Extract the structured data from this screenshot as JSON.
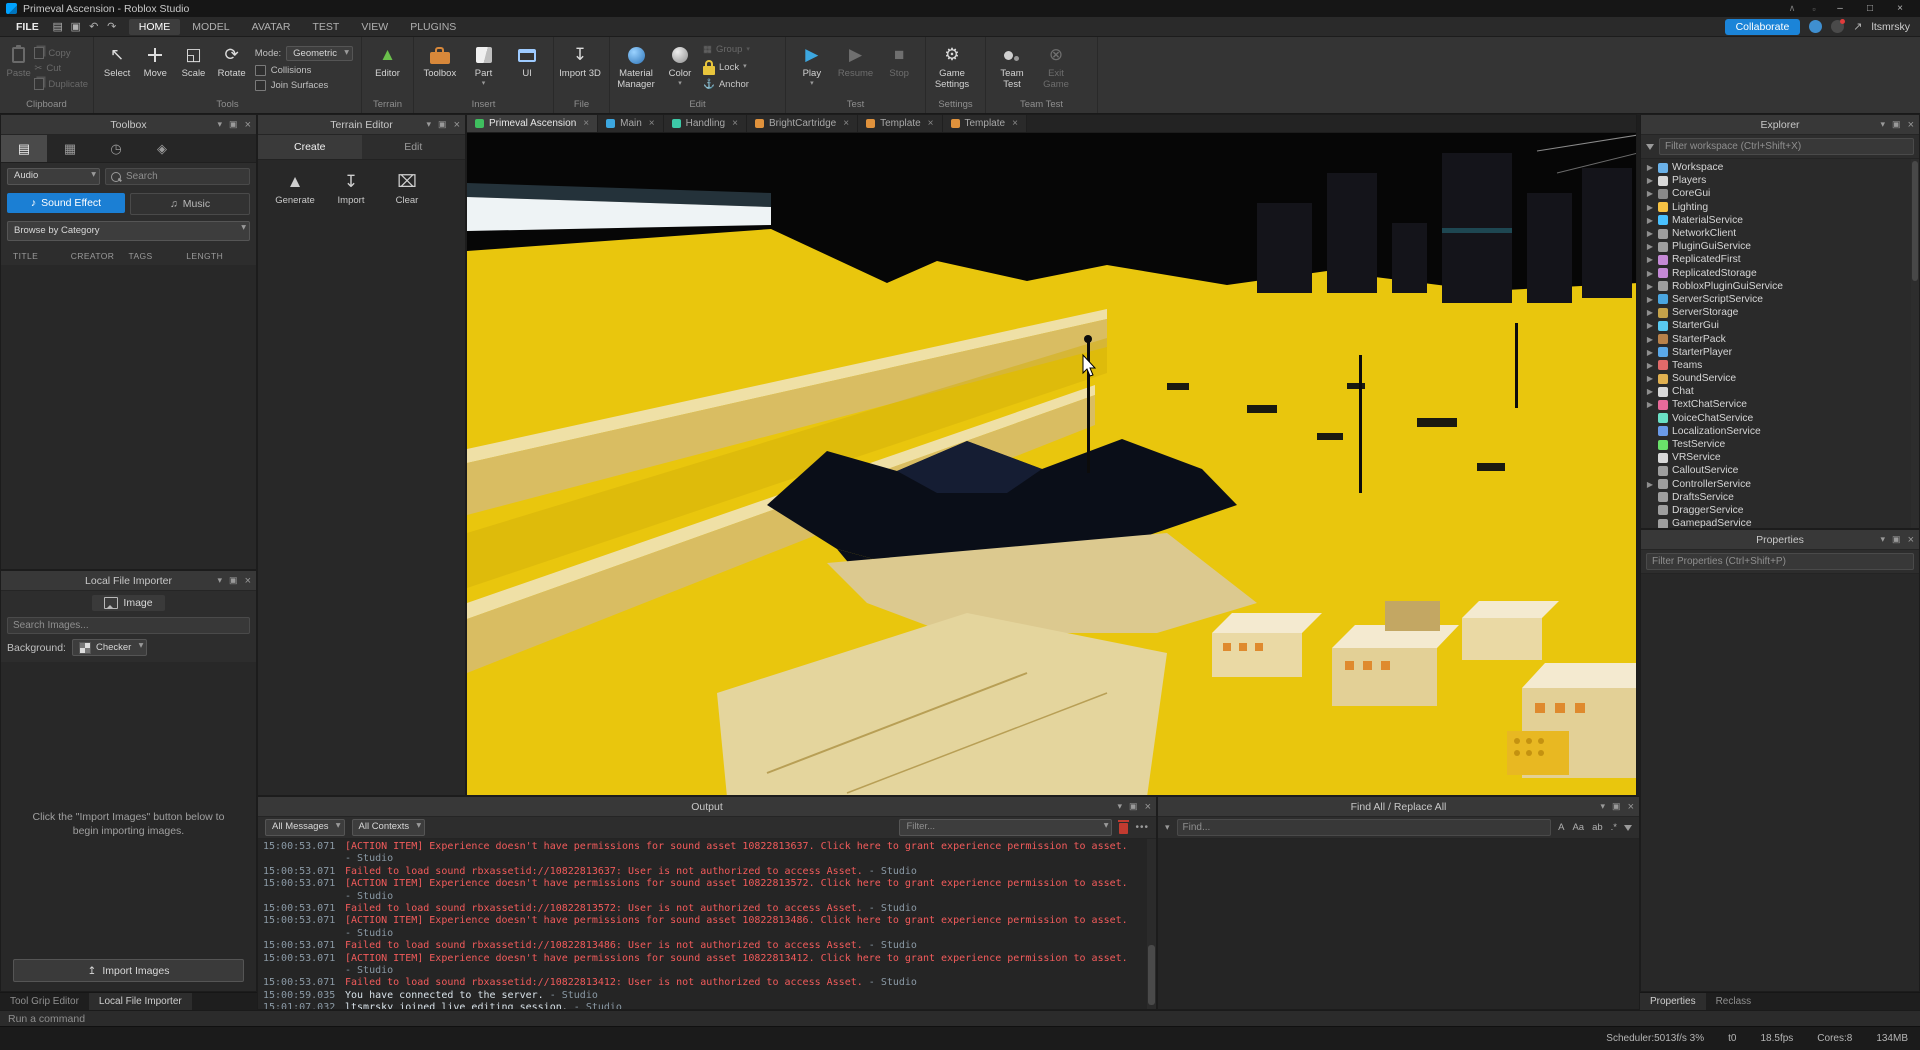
{
  "titlebar": {
    "title": "Primeval Ascension - Roblox Studio"
  },
  "menubar": {
    "file_label": "FILE",
    "icons": [
      {
        "name": "open-icon",
        "glyph": "▤"
      },
      {
        "name": "save-icon",
        "glyph": "▣"
      },
      {
        "name": "undo-icon",
        "glyph": "↶"
      },
      {
        "name": "redo-icon",
        "glyph": "↷"
      }
    ],
    "tabs": [
      {
        "label": "HOME",
        "active": true
      },
      {
        "label": "MODEL",
        "active": false
      },
      {
        "label": "AVATAR",
        "active": false
      },
      {
        "label": "TEST",
        "active": false
      },
      {
        "label": "VIEW",
        "active": false
      },
      {
        "label": "PLUGINS",
        "active": false
      }
    ],
    "collaborate_label": "Collaborate",
    "username": "ltsmrsky"
  },
  "ribbon": {
    "clipboard": {
      "label": "Clipboard",
      "paste": "Paste",
      "copy": "Copy",
      "cut": "Cut",
      "duplicate": "Duplicate"
    },
    "tools": {
      "label": "Tools",
      "select": "Select",
      "move": "Move",
      "scale": "Scale",
      "rotate": "Rotate",
      "mode_label": "Mode:",
      "mode_value": "Geometric",
      "collisions": "Collisions",
      "join_surfaces": "Join Surfaces"
    },
    "terrain": {
      "label": "Terrain",
      "editor": "Editor"
    },
    "insert": {
      "label": "Insert",
      "toolbox": "Toolbox",
      "part": "Part",
      "ui": "UI"
    },
    "file": {
      "label": "File",
      "import_3d": "Import 3D"
    },
    "edit": {
      "label": "Edit",
      "material_manager": "Material Manager",
      "color": "Color",
      "group": "Group",
      "lock": "Lock",
      "anchor": "Anchor"
    },
    "test": {
      "label": "Test",
      "play": "Play",
      "resume": "Resume",
      "stop": "Stop"
    },
    "settings": {
      "label": "Settings",
      "game_settings": "Game Settings"
    },
    "team_test": {
      "label": "Team Test",
      "team_test": "Team Test",
      "exit_game": "Exit Game"
    }
  },
  "toolbox": {
    "title": "Toolbox",
    "tabs": [
      {
        "name": "marketplace-tab",
        "glyph": "▤",
        "active": true
      },
      {
        "name": "inventory-tab",
        "glyph": "▦",
        "active": false
      },
      {
        "name": "recent-tab",
        "glyph": "◷",
        "active": false
      },
      {
        "name": "creations-tab",
        "glyph": "◈",
        "active": false
      }
    ],
    "category_value": "Audio",
    "search_placeholder": "Search",
    "sound_effect_label": "Sound Effect",
    "music_label": "Music",
    "browse_label": "Browse by Category",
    "columns": [
      "TITLE",
      "CREATOR",
      "TAGS",
      "LENGTH"
    ]
  },
  "local_file_importer": {
    "title": "Local File Importer",
    "tab_label": "Image",
    "search_placeholder": "Search Images...",
    "background_label": "Background:",
    "background_value": "Checker",
    "empty_text": "Click the \"Import Images\" button below to begin importing images.",
    "import_button": "Import Images"
  },
  "terrain_editor": {
    "title": "Terrain Editor",
    "tabs": [
      {
        "label": "Create",
        "active": true
      },
      {
        "label": "Edit",
        "active": false
      }
    ],
    "buttons": [
      {
        "label": "Generate",
        "glyph": "▲",
        "icon": "generate-icon"
      },
      {
        "label": "Import",
        "glyph": "↧",
        "icon": "import-icon"
      },
      {
        "label": "Clear",
        "glyph": "⌧",
        "icon": "clear-icon"
      }
    ]
  },
  "document_tabs": [
    {
      "label": "Primeval Ascension",
      "color": "#3fbf5f",
      "active": true
    },
    {
      "label": "Main",
      "color": "#3ca7e0",
      "active": false
    },
    {
      "label": "Handling",
      "color": "#3cc9a7",
      "active": false
    },
    {
      "label": "BrightCartridge",
      "color": "#e0923c",
      "active": false
    },
    {
      "label": "Template",
      "color": "#e0923c",
      "active": false
    },
    {
      "label": "Template",
      "color": "#e0923c",
      "active": false
    }
  ],
  "viewport": {
    "sky_color": "#060606",
    "ground_color": "#e9c60d"
  },
  "explorer": {
    "title": "Explorer",
    "filter_placeholder": "Filter workspace (Ctrl+Shift+X)",
    "items": [
      {
        "label": "Workspace",
        "color": "#6ab1e8",
        "arrow": true
      },
      {
        "label": "Players",
        "color": "#d8d8d8",
        "arrow": true
      },
      {
        "label": "CoreGui",
        "color": "#8a8a8a",
        "arrow": true
      },
      {
        "label": "Lighting",
        "color": "#f6c244",
        "arrow": true
      },
      {
        "label": "MaterialService",
        "color": "#49c1ff",
        "arrow": true
      },
      {
        "label": "NetworkClient",
        "color": "#9e9e9e",
        "arrow": true
      },
      {
        "label": "PluginGuiService",
        "color": "#9e9e9e",
        "arrow": true
      },
      {
        "label": "ReplicatedFirst",
        "color": "#c589d6",
        "arrow": true
      },
      {
        "label": "ReplicatedStorage",
        "color": "#c589d6",
        "arrow": true
      },
      {
        "label": "RobloxPluginGuiService",
        "color": "#9e9e9e",
        "arrow": true
      },
      {
        "label": "ServerScriptService",
        "color": "#4aa6e0",
        "arrow": true
      },
      {
        "label": "ServerStorage",
        "color": "#c5a24a",
        "arrow": true
      },
      {
        "label": "StarterGui",
        "color": "#59c9f0",
        "arrow": true
      },
      {
        "label": "StarterPack",
        "color": "#b9824a",
        "arrow": true
      },
      {
        "label": "StarterPlayer",
        "color": "#5aa8e8",
        "arrow": true
      },
      {
        "label": "Teams",
        "color": "#e06a6a",
        "arrow": true
      },
      {
        "label": "SoundService",
        "color": "#e0b050",
        "arrow": true
      },
      {
        "label": "Chat",
        "color": "#d8d8d8",
        "arrow": true
      },
      {
        "label": "TextChatService",
        "color": "#e86a9a",
        "arrow": true
      },
      {
        "label": "VoiceChatService",
        "color": "#6ae0c5",
        "arrow": false
      },
      {
        "label": "LocalizationService",
        "color": "#6a9ae8",
        "arrow": false
      },
      {
        "label": "TestService",
        "color": "#6ae06a",
        "arrow": false
      },
      {
        "label": "VRService",
        "color": "#d8d8d8",
        "arrow": false
      },
      {
        "label": "CalloutService",
        "color": "#9e9e9e",
        "arrow": false
      },
      {
        "label": "ControllerService",
        "color": "#9e9e9e",
        "arrow": true
      },
      {
        "label": "DraftsService",
        "color": "#9e9e9e",
        "arrow": false
      },
      {
        "label": "DraggerService",
        "color": "#9e9e9e",
        "arrow": false
      },
      {
        "label": "GamepadService",
        "color": "#9e9e9e",
        "arrow": false
      }
    ]
  },
  "properties": {
    "title": "Properties",
    "filter_placeholder": "Filter Properties (Ctrl+Shift+P)"
  },
  "output": {
    "title": "Output",
    "messages_filter": "All Messages",
    "contexts_filter": "All Contexts",
    "filter_placeholder": "Filter...",
    "lines": [
      {
        "time": "15:00:53.071",
        "text": "[ACTION ITEM] Experience doesn't have permissions for sound asset 10822813637. Click here to grant experience permission to asset.",
        "suffix": "",
        "color": "#f25b5b"
      },
      {
        "time": "",
        "text": "-  Studio",
        "suffix": "",
        "color": "#8a99a5"
      },
      {
        "time": "15:00:53.071",
        "text": "Failed to load sound rbxassetid://10822813637: User is not authorized to access Asset.",
        "suffix": "  -  Studio",
        "color": "#f25b5b"
      },
      {
        "time": "15:00:53.071",
        "text": "[ACTION ITEM] Experience doesn't have permissions for sound asset 10822813572. Click here to grant experience permission to asset.",
        "suffix": "",
        "color": "#f25b5b"
      },
      {
        "time": "",
        "text": "-  Studio",
        "suffix": "",
        "color": "#8a99a5"
      },
      {
        "time": "15:00:53.071",
        "text": "Failed to load sound rbxassetid://10822813572: User is not authorized to access Asset.",
        "suffix": "  -  Studio",
        "color": "#f25b5b"
      },
      {
        "time": "15:00:53.071",
        "text": "[ACTION ITEM] Experience doesn't have permissions for sound asset 10822813486. Click here to grant experience permission to asset.",
        "suffix": "",
        "color": "#f25b5b"
      },
      {
        "time": "",
        "text": "-  Studio",
        "suffix": "",
        "color": "#8a99a5"
      },
      {
        "time": "15:00:53.071",
        "text": "Failed to load sound rbxassetid://10822813486: User is not authorized to access Asset.",
        "suffix": "  -  Studio",
        "color": "#f25b5b"
      },
      {
        "time": "15:00:53.071",
        "text": "[ACTION ITEM] Experience doesn't have permissions for sound asset 10822813412. Click here to grant experience permission to asset.",
        "suffix": "",
        "color": "#f25b5b"
      },
      {
        "time": "",
        "text": "-  Studio",
        "suffix": "",
        "color": "#8a99a5"
      },
      {
        "time": "15:00:53.071",
        "text": "Failed to load sound rbxassetid://10822813412: User is not authorized to access Asset.",
        "suffix": "  -  Studio",
        "color": "#f25b5b"
      },
      {
        "time": "15:00:59.035",
        "text": "You have connected to the server.",
        "suffix": "  -  Studio",
        "color": "#d7e1e8"
      },
      {
        "time": "15:01:07.032",
        "text": "ltsmrsky joined live editing session.",
        "suffix": "  -  Studio",
        "color": "#d7e1e8"
      }
    ]
  },
  "find_panel": {
    "title": "Find All / Replace All",
    "find_placeholder": "Find...",
    "icons": [
      {
        "name": "match-case-icon",
        "glyph": "A"
      },
      {
        "name": "preserve-case-icon",
        "glyph": "Aa"
      },
      {
        "name": "whole-word-icon",
        "glyph": "ab"
      },
      {
        "name": "regex-icon",
        "glyph": ".*"
      }
    ]
  },
  "dock_tabs_left": [
    {
      "label": "Tool Grip Editor",
      "active": false
    },
    {
      "label": "Local File Importer",
      "active": true
    }
  ],
  "dock_tabs_right": [
    {
      "label": "Properties",
      "active": true
    },
    {
      "label": "Reclass",
      "active": false
    }
  ],
  "command_bar": {
    "placeholder": "Run a command"
  },
  "status_bar": {
    "stats": [
      "Scheduler:5013f/s 3%",
      "t0",
      "18.5fps",
      "Cores:8",
      "134MB"
    ]
  }
}
